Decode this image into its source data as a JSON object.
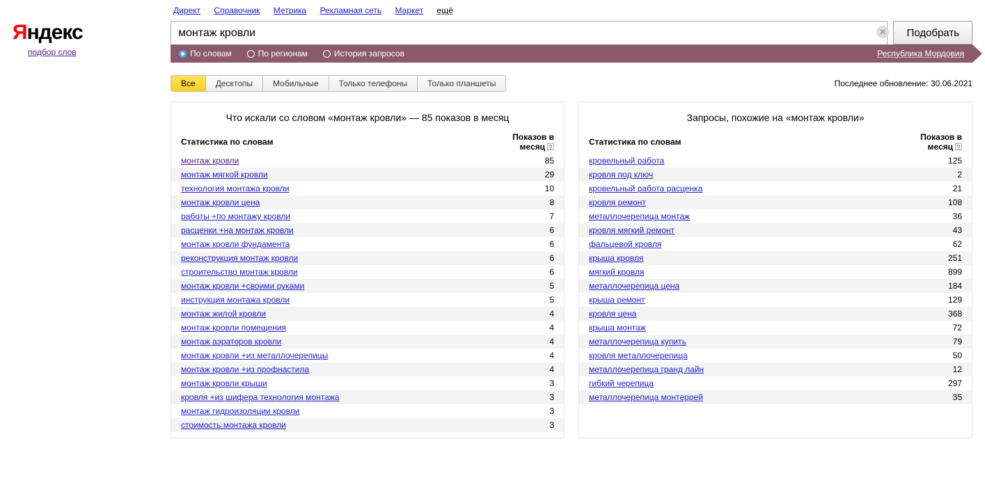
{
  "logo": {
    "red": "Я",
    "black": "ндекс",
    "sub": "подбор слов"
  },
  "top_nav": [
    "Директ",
    "Справочник",
    "Метрика",
    "Рекламная сеть",
    "Маркет"
  ],
  "top_nav_more": "ещё",
  "search": {
    "value": "монтаж кровли",
    "submit": "Подобрать"
  },
  "filter": {
    "options": [
      "По словам",
      "По регионам",
      "История запросов"
    ],
    "checked_index": 0,
    "region": "Республика Мордовия"
  },
  "device_tabs": [
    "Все",
    "Десктопы",
    "Мобильные",
    "Только телефоны",
    "Только планшеты"
  ],
  "device_active": 0,
  "last_update_label": "Последнее обновление:",
  "last_update_value": "30.06.2021",
  "col_headers": {
    "word": "Статистика по словам",
    "shows": "Показов в месяц"
  },
  "left_panel": {
    "title": "Что искали со словом «монтаж кровли» — 85 показов в месяц",
    "rows": [
      {
        "word": "монтаж кровли",
        "shows": 85,
        "visited": true
      },
      {
        "word": "монтаж мягкой кровли",
        "shows": 29
      },
      {
        "word": "технология монтажа кровли",
        "shows": 10
      },
      {
        "word": "монтаж кровли цена",
        "shows": 8
      },
      {
        "word": "работы +по монтажу кровли",
        "shows": 7
      },
      {
        "word": "расценки +на монтаж кровли",
        "shows": 6
      },
      {
        "word": "монтаж кровли фундамента",
        "shows": 6
      },
      {
        "word": "реконструкция монтаж кровли",
        "shows": 6
      },
      {
        "word": "строительство монтаж кровли",
        "shows": 6
      },
      {
        "word": "монтаж кровли +своими руками",
        "shows": 5
      },
      {
        "word": "инструкция монтажа кровли",
        "shows": 5
      },
      {
        "word": "монтаж жилой кровли",
        "shows": 4
      },
      {
        "word": "монтаж кровли помещения",
        "shows": 4
      },
      {
        "word": "монтаж аэраторов кровли",
        "shows": 4
      },
      {
        "word": "монтаж кровли +из металлочерепицы",
        "shows": 4
      },
      {
        "word": "монтаж кровли +из профнастила",
        "shows": 4
      },
      {
        "word": "монтаж кровли крыши",
        "shows": 3
      },
      {
        "word": "кровля +из шифера технология монтажа",
        "shows": 3
      },
      {
        "word": "монтаж гидроизоляции кровли",
        "shows": 3
      },
      {
        "word": "стоимость монтажа кровли",
        "shows": 3
      }
    ]
  },
  "right_panel": {
    "title": "Запросы, похожие на «монтаж кровли»",
    "rows": [
      {
        "word": "кровельный работа",
        "shows": 125
      },
      {
        "word": "кровля под ключ",
        "shows": 2
      },
      {
        "word": "кровельный работа расценка",
        "shows": 21
      },
      {
        "word": "кровля ремонт",
        "shows": 108
      },
      {
        "word": "металлочерепица монтаж",
        "shows": 36
      },
      {
        "word": "кровля мягкий ремонт",
        "shows": 43
      },
      {
        "word": "фальцевой кровля",
        "shows": 62
      },
      {
        "word": "крыша кровля",
        "shows": 251
      },
      {
        "word": "мягкий кровля",
        "shows": 899
      },
      {
        "word": "металлочерепица цена",
        "shows": 184
      },
      {
        "word": "крыша ремонт",
        "shows": 129
      },
      {
        "word": "кровля цена",
        "shows": 368
      },
      {
        "word": "крыша монтаж",
        "shows": 72
      },
      {
        "word": "металлочерепица купить",
        "shows": 79
      },
      {
        "word": "кровля металлочерепица",
        "shows": 50
      },
      {
        "word": "металлочерепица гранд лайн",
        "shows": 12
      },
      {
        "word": "гибкий черепица",
        "shows": 297
      },
      {
        "word": "металлочерепица монтеррей",
        "shows": 35
      }
    ]
  }
}
